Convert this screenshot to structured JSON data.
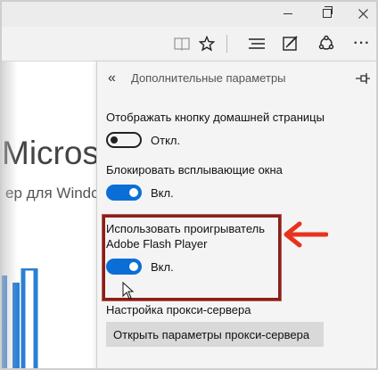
{
  "window": {
    "controls": [
      "minimize-icon",
      "maximize-icon",
      "close-icon"
    ]
  },
  "toolbar": {
    "icons": [
      "reading-view-icon",
      "favorites-star-icon",
      "hub-icon",
      "web-note-icon",
      "share-icon",
      "more-icon"
    ],
    "more_label": "···"
  },
  "webpage": {
    "title": "Microso",
    "subtitle": "ер для Windo"
  },
  "panel": {
    "back_icon": "«",
    "title": "Дополнительные параметры",
    "pin_icon": "pin-icon",
    "settings": [
      {
        "label": "Отображать кнопку домашней страницы",
        "state": "Откл.",
        "on": false
      },
      {
        "label": "Блокировать всплывающие окна",
        "state": "Вкл.",
        "on": true
      },
      {
        "label_line1": "Использовать проигрыватель",
        "label_line2": "Adobe Flash Player",
        "state": "Вкл.",
        "on": true
      }
    ],
    "proxy": {
      "label": "Настройка прокси-сервера",
      "button": "Открыть параметры прокси-сервера"
    }
  },
  "colors": {
    "accent": "#0a6ed6",
    "highlight_border": "#8b1f1a",
    "arrow": "#e8321e"
  }
}
